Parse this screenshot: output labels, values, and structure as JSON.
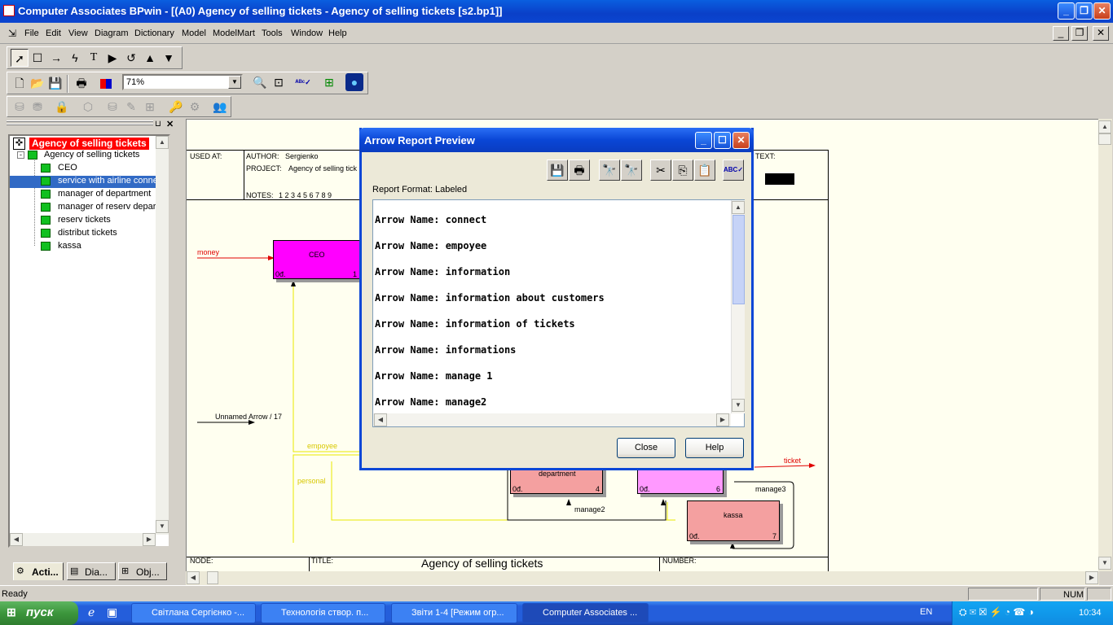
{
  "window": {
    "title": "Computer Associates BPwin - [(A0) Agency of selling tickets - Agency of selling tickets  [s2.bp1]]"
  },
  "menu": {
    "items": [
      "File",
      "Edit",
      "View",
      "Diagram",
      "Dictionary",
      "Model",
      "ModelMart",
      "Tools",
      "Window",
      "Help"
    ]
  },
  "toolbar": {
    "zoom": "71%"
  },
  "tree": {
    "root": "Agency of selling tickets",
    "parent": "Agency of selling tickets",
    "children": [
      "CEO",
      "service with airline conne",
      "manager of department",
      "manager of reserv  depar",
      "reserv tickets",
      "distribut tickets",
      "kassa"
    ],
    "selected_index": 1
  },
  "left_tabs": [
    "Acti...",
    "Dia...",
    "Obj..."
  ],
  "diagram": {
    "used_at": "USED AT:",
    "author_label": "AUTHOR:",
    "author": "Sergienko",
    "project_label": "PROJECT:",
    "project": "Agency of selling tick",
    "notes_label": "NOTES:",
    "notes": "1  2  3  4  5  6  7  8  9",
    "text_label": "TEXT:",
    "node_label": "NODE:",
    "title_label": "TITLE:",
    "title": "Agency of selling tickets",
    "number_label": "NUMBER:",
    "boxes": {
      "ceo": {
        "name": "CEO",
        "cost": "0đ.",
        "num": "1"
      },
      "department": {
        "name": "department",
        "cost": "0đ.",
        "num": "4"
      },
      "b6": {
        "cost": "0đ.",
        "num": "6"
      },
      "kassa": {
        "name": "kassa",
        "cost": "0đ.",
        "num": "7"
      }
    },
    "arrows": {
      "money": "money",
      "unnamed": "Unnamed Arrow / 17",
      "empoyee": "empoyee",
      "personal": "personal",
      "ticket": "ticket",
      "manage2": "manage2",
      "manage3": "manage3"
    }
  },
  "dialog": {
    "title": "Arrow Report Preview",
    "format_label": "Report Format: Labeled",
    "lines": [
      "Arrow Name: connect",
      "Arrow Name: empoyee",
      "Arrow Name: information",
      "Arrow Name: information about customers",
      "Arrow Name: information of tickets",
      "Arrow Name: informations",
      "Arrow Name: manage 1",
      "Arrow Name: manage2"
    ],
    "close_label": "Close",
    "help_label": "Help"
  },
  "status": {
    "text": "Ready",
    "num": "NUM"
  },
  "taskbar": {
    "start": "пуск",
    "tasks": [
      "Світлана Сергієнко -...",
      "Технологія створ. п...",
      "Звіти 1-4 [Режим огр...",
      "Computer Associates ..."
    ],
    "lang": "EN",
    "time": "10:34"
  },
  "colors": {
    "title_blue": "#0a46d6",
    "ceo_box": "#ff00ff",
    "pink_box": "#f4a0a0",
    "arrow_red": "#e00000",
    "arrow_yellow": "#e8e800",
    "tree_selected": "#316ac5",
    "tree_root": "#ff0000"
  }
}
